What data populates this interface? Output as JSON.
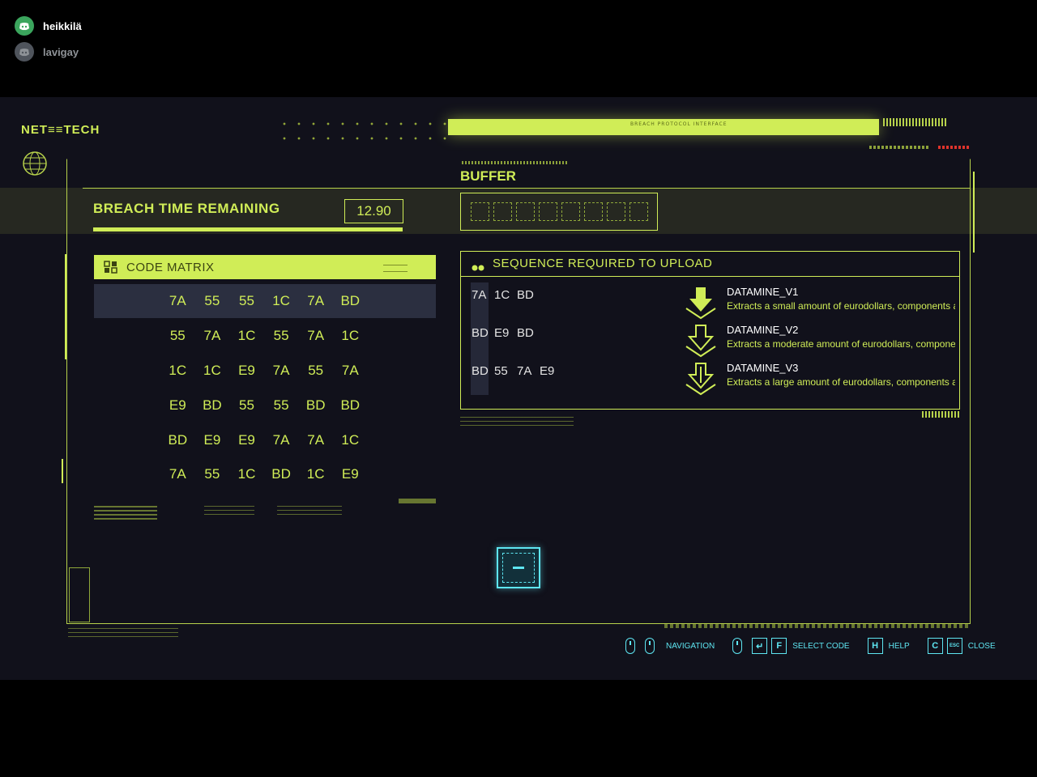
{
  "overlay": {
    "users": [
      {
        "name": "heikkilä",
        "state": "active"
      },
      {
        "name": "lavigay",
        "state": "muted"
      }
    ]
  },
  "logo": "NET≡≡TECH",
  "top_bar_label": "BREACH PROTOCOL INTERFACE",
  "breach": {
    "label": "BREACH TIME REMAINING",
    "time": "12.90",
    "progress": 1.0
  },
  "buffer": {
    "label": "BUFFER",
    "slots": 8
  },
  "matrix": {
    "title": "CODE MATRIX",
    "rows": [
      [
        "7A",
        "55",
        "55",
        "1C",
        "7A",
        "BD"
      ],
      [
        "55",
        "7A",
        "1C",
        "55",
        "7A",
        "1C"
      ],
      [
        "1C",
        "1C",
        "E9",
        "7A",
        "55",
        "7A"
      ],
      [
        "E9",
        "BD",
        "55",
        "55",
        "BD",
        "BD"
      ],
      [
        "BD",
        "E9",
        "E9",
        "7A",
        "7A",
        "1C"
      ],
      [
        "7A",
        "55",
        "1C",
        "BD",
        "1C",
        "E9"
      ]
    ]
  },
  "sequence": {
    "title": "SEQUENCE REQUIRED TO UPLOAD",
    "rows": [
      [
        "7A",
        "1C",
        "BD"
      ],
      [
        "BD",
        "E9",
        "BD"
      ],
      [
        "BD",
        "55",
        "7A",
        "E9"
      ]
    ],
    "daemons": [
      {
        "name": "DATAMINE_V1",
        "desc": "Extracts a small amount of eurodollars, components and quickhacks."
      },
      {
        "name": "DATAMINE_V2",
        "desc": "Extracts a moderate amount of eurodollars, components and quickhacks."
      },
      {
        "name": "DATAMINE_V3",
        "desc": "Extracts a large amount of eurodollars, components and quickhacks."
      }
    ]
  },
  "help": {
    "navigation": "NAVIGATION",
    "select": "SELECT CODE",
    "help": "HELP",
    "close": "CLOSE",
    "keys": {
      "f": "F",
      "h": "H",
      "c": "C",
      "esc": "ESC"
    }
  },
  "colors": {
    "accent": "#d0ed57",
    "cyan": "#5ee6f2",
    "background": "#11111b",
    "warning": "#e0342c"
  }
}
